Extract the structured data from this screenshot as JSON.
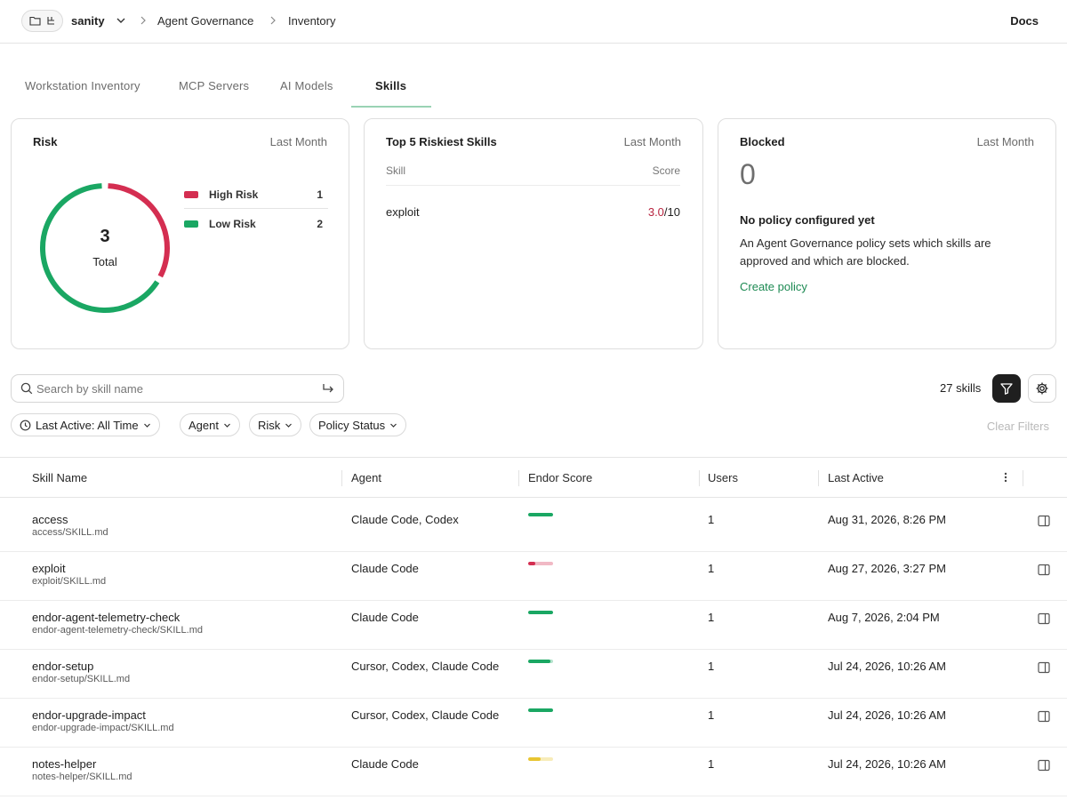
{
  "topbar": {
    "workspace": "sanity",
    "breadcrumbs": [
      "Agent Governance",
      "Inventory"
    ],
    "docs_label": "Docs"
  },
  "tabs": [
    {
      "label": "Workstation Inventory",
      "active": false
    },
    {
      "label": "MCP Servers",
      "active": false
    },
    {
      "label": "AI Models",
      "active": false
    },
    {
      "label": "Skills",
      "active": true
    }
  ],
  "risk_card": {
    "title": "Risk",
    "period": "Last Month",
    "total": "3",
    "total_label": "Total",
    "legend": [
      {
        "label": "High Risk",
        "count": "1",
        "color": "#d42e51"
      },
      {
        "label": "Low Risk",
        "count": "2",
        "color": "#1aa763"
      }
    ]
  },
  "top5_card": {
    "title": "Top 5 Riskiest Skills",
    "period": "Last Month",
    "col_skill": "Skill",
    "col_score": "Score",
    "rows": [
      {
        "skill": "exploit",
        "score": "3.0",
        "max": "/10"
      }
    ]
  },
  "blocked_card": {
    "title": "Blocked",
    "period": "Last Month",
    "count": "0",
    "empty_title": "No policy configured yet",
    "empty_desc": "An Agent Governance policy sets which skills are approved and which are blocked.",
    "link": "Create policy"
  },
  "toolbar": {
    "search_placeholder": "Search by skill name",
    "skills_count": "27 skills",
    "clear_filters": "Clear Filters",
    "filters": [
      "Last Active: All Time",
      "Agent",
      "Risk",
      "Policy Status"
    ]
  },
  "table": {
    "columns": [
      "Skill Name",
      "Agent",
      "Endor Score",
      "Users",
      "Last Active"
    ],
    "rows": [
      {
        "name": "access",
        "path": "access/SKILL.md",
        "agent": "Claude Code, Codex",
        "score_fraction": 1.0,
        "score_color": "#1aa763",
        "users": "1",
        "last_active": "Aug 31, 2026, 8:26 PM"
      },
      {
        "name": "exploit",
        "path": "exploit/SKILL.md",
        "agent": "Claude Code",
        "score_fraction": 0.3,
        "score_color": "#d42e51",
        "users": "1",
        "last_active": "Aug 27, 2026, 3:27 PM"
      },
      {
        "name": "endor-agent-telemetry-check",
        "path": "endor-agent-telemetry-check/SKILL.md",
        "agent": "Claude Code",
        "score_fraction": 1.0,
        "score_color": "#1aa763",
        "users": "1",
        "last_active": "Aug 7, 2026, 2:04 PM"
      },
      {
        "name": "endor-setup",
        "path": "endor-setup/SKILL.md",
        "agent": "Cursor, Codex, Claude Code",
        "score_fraction": 0.9,
        "score_color": "#1aa763",
        "users": "1",
        "last_active": "Jul 24, 2026, 10:26 AM"
      },
      {
        "name": "endor-upgrade-impact",
        "path": "endor-upgrade-impact/SKILL.md",
        "agent": "Cursor, Codex, Claude Code",
        "score_fraction": 1.0,
        "score_color": "#1aa763",
        "users": "1",
        "last_active": "Jul 24, 2026, 10:26 AM"
      },
      {
        "name": "notes-helper",
        "path": "notes-helper/SKILL.md",
        "agent": "Claude Code",
        "score_fraction": 0.5,
        "score_color": "#e8c531",
        "users": "1",
        "last_active": "Jul 24, 2026, 10:26 AM"
      }
    ]
  }
}
